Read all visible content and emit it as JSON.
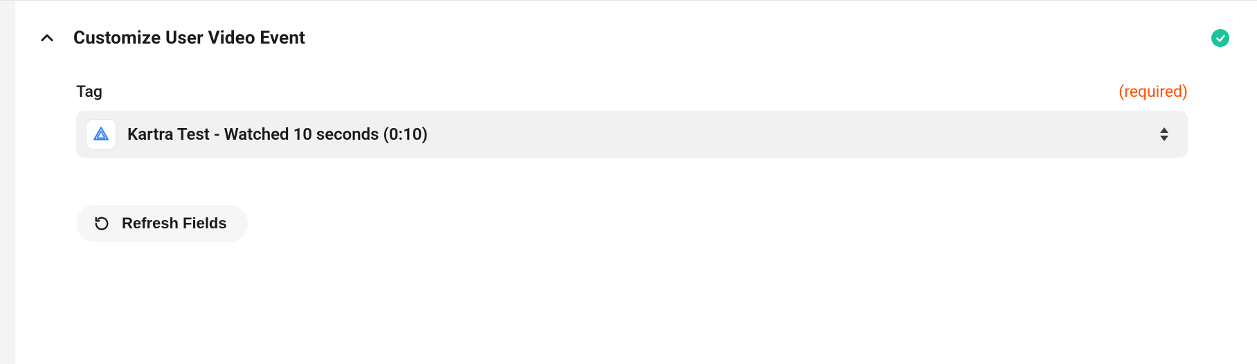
{
  "section": {
    "title": "Customize User Video Event",
    "status": "success"
  },
  "field": {
    "label": "Tag",
    "required_text": "(required)",
    "selected_value": "Kartra Test - Watched 10 seconds (0:10)",
    "app_icon": "triangle-icon"
  },
  "actions": {
    "refresh_label": "Refresh Fields"
  }
}
